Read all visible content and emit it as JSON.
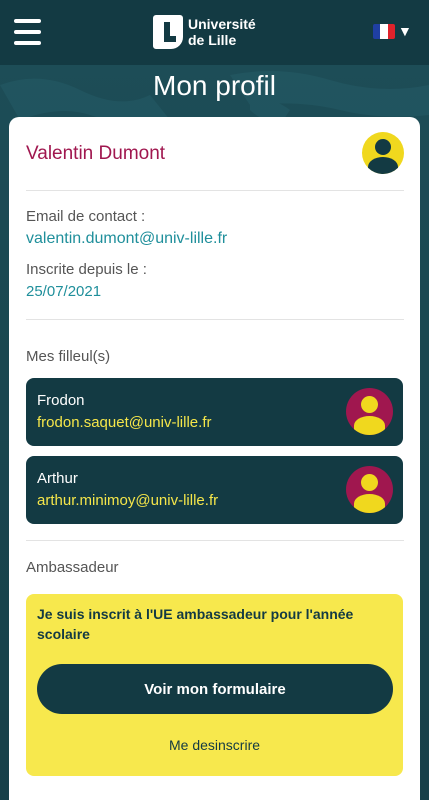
{
  "header": {
    "logo_line1": "Université",
    "logo_line2": "de Lille",
    "lang_caret": "▼",
    "flag_colors": [
      "#1f3fa3",
      "#ffffff",
      "#e0222b"
    ]
  },
  "page_title": "Mon profil",
  "profile": {
    "name": "Valentin Dumont",
    "email_label": "Email de contact :",
    "email": "valentin.dumont@univ-lille.fr",
    "since_label": "Inscrite depuis le :",
    "since": "25/07/2021"
  },
  "godchildren": {
    "section_label": "Mes filleul(s)",
    "items": [
      {
        "name": "Frodon",
        "email": "frodon.saquet@univ-lille.fr"
      },
      {
        "name": "Arthur",
        "email": "arthur.minimoy@univ-lille.fr"
      }
    ]
  },
  "ambassador": {
    "section_label": "Ambassadeur",
    "text": "Je suis inscrit à l'UE ambassadeur pour l'année scolaire",
    "button_label": "Voir mon formulaire",
    "unsubscribe_label": "Me desinscrire"
  },
  "colors": {
    "primary_dark": "#133a43",
    "accent_yellow": "#f7e84d",
    "name_color": "#a0174f",
    "link_teal": "#1f8f9b",
    "godchild_avatar_bg": "#a0174f"
  }
}
